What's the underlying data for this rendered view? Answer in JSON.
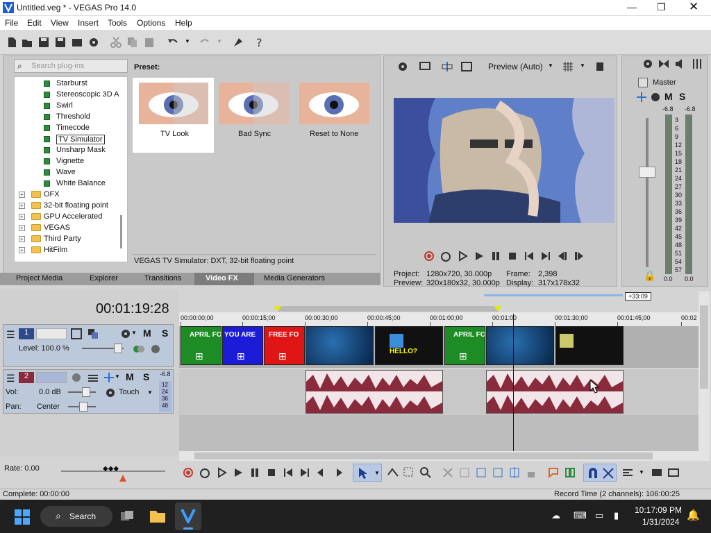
{
  "title": "Untitled.veg * - VEGAS Pro 14.0",
  "menu": [
    "File",
    "Edit",
    "View",
    "Insert",
    "Tools",
    "Options",
    "Help"
  ],
  "plugins": {
    "search_placeholder": "Search plug-ins",
    "fx_items": [
      "Starburst",
      "Stereoscopic 3D A",
      "Swirl",
      "Threshold",
      "Timecode",
      "TV Simulator",
      "Unsharp Mask",
      "Vignette",
      "Wave",
      "White Balance"
    ],
    "folders": [
      "OFX",
      "32-bit floating point",
      "GPU Accelerated",
      "VEGAS",
      "Third Party",
      "HitFilm"
    ]
  },
  "preset": {
    "label": "Preset:",
    "items": [
      "TV Look",
      "Bad Sync",
      "Reset to None"
    ],
    "status": "VEGAS TV Simulator: DXT, 32-bit floating point"
  },
  "tabs": [
    "Project Media",
    "Explorer",
    "Transitions",
    "Video FX",
    "Media Generators"
  ],
  "preview": {
    "mode": "Preview (Auto)",
    "project_label": "Project:",
    "project_val": "1280x720, 30.000p",
    "preview_label": "Preview:",
    "preview_val": "320x180x32, 30.000p",
    "frame_label": "Frame:",
    "frame_val": "2,398",
    "display_label": "Display:",
    "display_val": "317x178x32"
  },
  "master": {
    "label": "Master",
    "left_peak": "-6.8",
    "right_peak": "-6.8",
    "scale": [
      "3",
      "6",
      "9",
      "12",
      "15",
      "18",
      "21",
      "24",
      "27",
      "30",
      "33",
      "36",
      "39",
      "42",
      "45",
      "48",
      "51",
      "54",
      "57"
    ],
    "left_val": "0.0",
    "right_val": "0.0"
  },
  "timeline": {
    "timecode": "00:01:19:28",
    "ruler": [
      "00:00:00;00",
      "00:00:15;00",
      "00:00:30;00",
      "00:00:45;00",
      "00:01:00;00",
      "00:01:00",
      "00:01:30;00",
      "00:01:45;00",
      "00:02"
    ],
    "marker": "+33:09"
  },
  "track1": {
    "num": "1",
    "level": "Level: 100.0 %"
  },
  "track2": {
    "num": "2",
    "vol_label": "Vol:",
    "vol_val": "0.0 dB",
    "pan_label": "Pan:",
    "pan_val": "Center",
    "touch": "Touch",
    "peak": "-6.8",
    "meter": [
      "12",
      "24",
      "36",
      "48"
    ]
  },
  "clips": {
    "c1": "APRIL FO",
    "c2": "YOU ARE",
    "c3": "FREE FO",
    "c6": "APRIL FO",
    "c5": "HELLO?"
  },
  "rate": "Rate: 0.00",
  "status": {
    "complete": "Complete: 00:00:00",
    "record": "Record Time (2 channels): 106:00:25"
  },
  "taskbar": {
    "search": "Search",
    "time": "10:17:09 PM",
    "date": "1/31/2024"
  },
  "colors": {
    "accent": "#2f6fd6",
    "audio": "#8a2a3d",
    "green": "#1d8c24",
    "blue": "#1b1bd8",
    "red": "#e01515"
  }
}
